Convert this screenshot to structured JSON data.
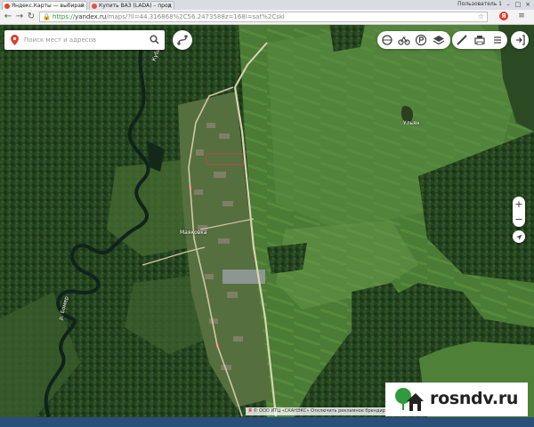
{
  "browser": {
    "tabs": [
      {
        "title": "Яндекс.Карты — выбирай",
        "favicon_color": "#e23d2d",
        "active": true
      },
      {
        "title": "Купить ВАЗ (LADA) – прод",
        "favicon_color": "#d9534f",
        "active": false
      }
    ],
    "window_user": "Пользователь 1",
    "url_scheme": "https://",
    "url_host": "yandex.ru",
    "url_path": "/maps/?ll=44.316868%2C56.2473588z=168l=sat%2Cskl",
    "extension_label": "Я"
  },
  "search": {
    "placeholder": "Поиск мест и адресов"
  },
  "map": {
    "labels": {
      "village": "Маяковка",
      "river_north": "Куба",
      "river_south": "р. Бомер",
      "field_label": "Ульян"
    },
    "zoom_in": "+",
    "zoom_out": "−"
  },
  "copyright": {
    "logo": "Я",
    "text": "© ООО ИТЦ «СКАНЭКС» Отключить рекламное брендирование"
  },
  "watermark": {
    "text": "rosndv.ru"
  },
  "colors": {
    "accent": "#e23d2d",
    "url_green": "#2a9d3a",
    "field": "#4a7a34",
    "forest": "#203c1c"
  }
}
